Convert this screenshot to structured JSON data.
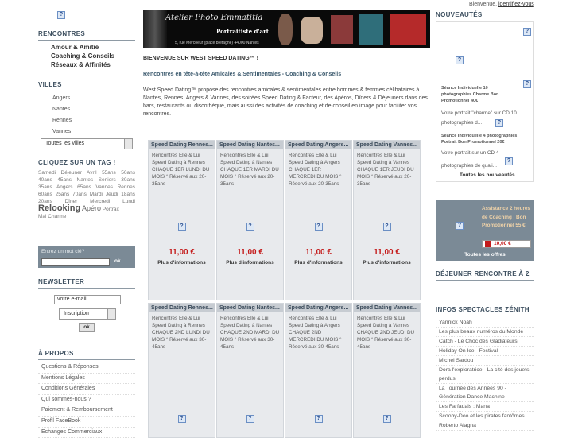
{
  "top": {
    "greeting": "Bienvenue,",
    "login_link": "identifiez-vous"
  },
  "banner": {
    "line1": "Atelier Photo Emmatitia",
    "line2": "Portraitiste d'art",
    "address": "5, rue Mercoeur (place bretagne) 44000 Nantes"
  },
  "left": {
    "rencontres_title": "RENCONTRES",
    "rencontres": [
      "Amour & Amitié",
      "Coaching & Conseils",
      "Réseaux & Affinités"
    ],
    "villes_title": "VILLES",
    "villes": [
      "Angers",
      "Nantes",
      "Rennes",
      "Vannes"
    ],
    "villes_select": "Toutes les villes",
    "tags_title": "CLIQUEZ SUR UN TAG !",
    "tags_line1": "Samedi Déjeuner Avril 55ans 50ans 40ans 45ans Nantes Seniors 30ans 35ans Angers 65ans Vannes Rennes 60ans 25ans 70ans Mardi Jeudi 18ans 20ans Dîner Mercredi Lundi",
    "tag_big": "Relooking",
    "tag_mid": "Apéro",
    "tag_small": "Portrait",
    "tags_line3": "Mai Charme",
    "search_label": "Entrez un mot clé?",
    "search_btn": "ok",
    "newsletter_title": "NEWSLETTER",
    "newsletter_placeholder": "votre e-mail",
    "newsletter_select": "Inscription",
    "newsletter_btn": "ok",
    "apropos_title": "À PROPOS",
    "apropos": [
      "Questions & Réponses",
      "Mentions Légales",
      "Conditions Générales",
      "Qui sommes-nous ?",
      "Paiement & Remboursement",
      "Profil FaceBook",
      "Echanges Commerciaux"
    ]
  },
  "center": {
    "welcome": "BIENVENUE SUR WEST SPEED DATING™ !",
    "subtitle": "Rencontres en tête-à-tête Amicales & Sentimentales - Coaching & Conseils",
    "intro": "West Speed Dating™ propose des rencontres amicales & sentimentales entre hommes & femmes célibataires à Nantes, Rennes, Angers & Vannes, des soirées Speed Dating & Facteur, des Apéros, Dîners & Déjeuners dans des bars, restaurants ou discothèque, mais aussi des activités de coaching et de conseil en image pour faciliter vos rencontres.",
    "events_row1": [
      {
        "title": "Speed Dating Rennes...",
        "desc": "Rencontres Elle & Lui Speed Dating à Rennes CHAQUE 1ER LUNDI DU MOIS ° Réservé aux 20-35ans",
        "price": "11,00 €",
        "more": "Plus d'informations"
      },
      {
        "title": "Speed Dating Nantes...",
        "desc": "Rencontres Elle & Lui Speed Dating à Nantes CHAQUE 1ER MARDI DU MOIS ° Réservé aux 20-35ans",
        "price": "11,00 €",
        "more": "Plus d'informations"
      },
      {
        "title": "Speed Dating Angers...",
        "desc": "Rencontres Elle & Lui Speed Dating à Angers CHAQUE 1ER MERCREDI DU MOIS ° Réservé aux 20-35ans",
        "price": "11,00 €",
        "more": "Plus d'informations"
      },
      {
        "title": "Speed Dating Vannes...",
        "desc": "Rencontres Elle & Lui Speed Dating à Vannes CHAQUE 1ER JEUDI DU MOIS ° Réservé aux 20-35ans",
        "price": "11,00 €",
        "more": "Plus d'informations"
      }
    ],
    "events_row2": [
      {
        "title": "Speed Dating Rennes...",
        "desc": "Rencontres Elle & Lui Speed Dating à Rennes CHAQUE 2ND LUNDI DU MOIS ° Réservé aux 30-45ans"
      },
      {
        "title": "Speed Dating Nantes...",
        "desc": "Rencontres Elle & Lui Speed Dating à Nantes CHAQUE 2ND MARDI DU MOIS ° Réservé aux 30-45ans"
      },
      {
        "title": "Speed Dating Angers...",
        "desc": "Rencontres Elle & Lui Speed Dating à Angers CHAQUE 2ND MERCREDI DU MOIS ° Réservé aux 30-45ans"
      },
      {
        "title": "Speed Dating Vannes...",
        "desc": "Rencontres Elle & Lui Speed Dating à Vannes CHAQUE 2ND JEUDI DU MOIS ° Réservé aux 30-45ans"
      }
    ]
  },
  "right": {
    "nouveautes_title": "NOUVEAUTÉS",
    "nouveaute1_title": "Séance Individuelle 10 photographies Charme Bon Promotionnel 40€",
    "nouveaute1_desc": "Votre portrait \"charme\" sur CD 10 photographies d...",
    "nouveaute2_title": "Séance Individuelle 4 photographies Portrait Bon Promotionnel 20€",
    "nouveaute2_desc": "Votre portrait sur un CD 4 photographies de quali...",
    "all_new": "Toutes les nouveautés",
    "promo_title": "Assistance 2 heures de Coaching | Bon Promotionnel 55 €",
    "promo_price": "10,00 €",
    "all_offers": "Toutes les offres",
    "dejeuner_title": "DÉJEUNER RENCONTRE À 2",
    "spectacles_title": "INFOS SPECTACLES ZÉNITH",
    "spectacles": [
      "Yannick Noah",
      "Les plus beaux numéros du Monde",
      "Catch - Le Choc des Gladiateurs",
      "Holiday On Ice - Festival",
      "Michel Sardou",
      "Dora l'exploratrice - La cité des jouets perdus",
      "La Tournée des Années 90 - Génération Dance Machine",
      "Les Farfadais : Mana",
      "Scooby-Doo et les pirates fantômes",
      "Roberto Alagna"
    ]
  }
}
